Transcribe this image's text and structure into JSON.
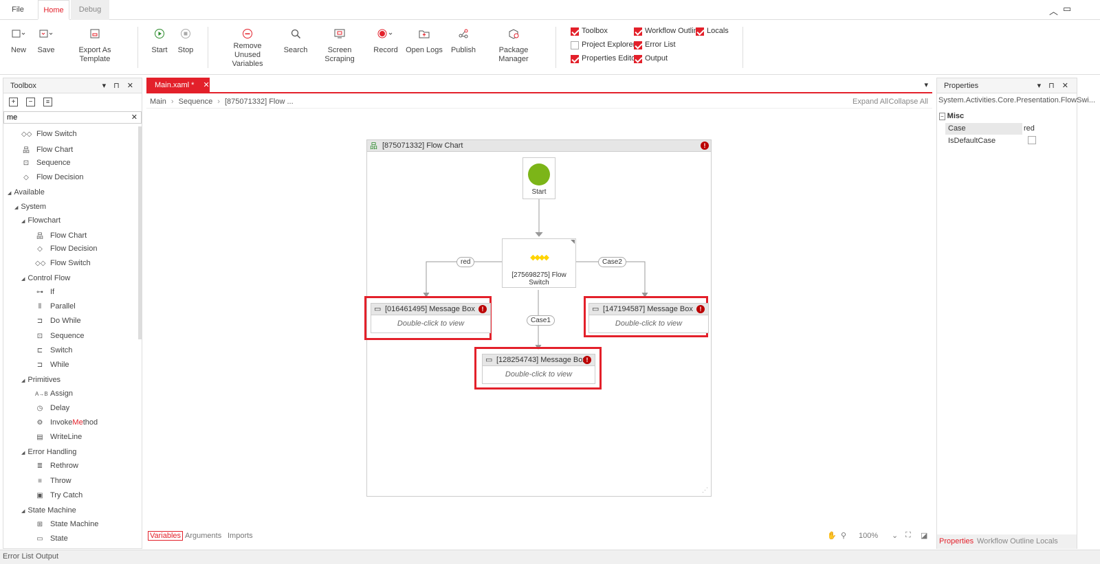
{
  "menubar": {
    "file": "File",
    "home": "Home",
    "debug": "Debug"
  },
  "ribbon": {
    "new": "New",
    "save": "Save",
    "export_template": "Export As Template",
    "start": "Start",
    "stop": "Stop",
    "remove_unused_1": "Remove Unused",
    "remove_unused_2": "Variables",
    "search": "Search",
    "screen_scraping": "Screen Scraping",
    "record": "Record",
    "open_logs": "Open Logs",
    "publish": "Publish",
    "package_manager": "Package Manager",
    "panels": [
      {
        "label": "Toolbox",
        "checked": true
      },
      {
        "label": "Project Explorer",
        "checked": false
      },
      {
        "label": "Properties Editor",
        "checked": true
      },
      {
        "label": "Workflow Outline",
        "checked": true
      },
      {
        "label": "Error List",
        "checked": true
      },
      {
        "label": "Output",
        "checked": true
      },
      {
        "label": "Locals",
        "checked": true
      }
    ]
  },
  "toolbox": {
    "title": "Toolbox",
    "search_value": "me",
    "recent": [
      "Flow Switch",
      "Flow Chart",
      "Sequence",
      "Flow Decision"
    ],
    "available": "Available",
    "system": "System",
    "flowchart": "Flowchart",
    "flowchart_items": [
      "Flow Chart",
      "Flow Decision",
      "Flow Switch"
    ],
    "control_flow": "Control Flow",
    "control_items": [
      "If",
      "Parallel",
      "Do While",
      "Sequence",
      "Switch",
      "While"
    ],
    "primitives": "Primitives",
    "primitive_items": [
      "Assign",
      "Delay",
      "InvokeMethod",
      "WriteLine"
    ],
    "invoke_pre": "Invoke",
    "invoke_hl": "Me",
    "invoke_post": "thod",
    "error_handling": "Error Handling",
    "error_items": [
      "Rethrow",
      "Throw",
      "Try Catch"
    ],
    "state_machine": "State Machine",
    "state_items": [
      "State Machine",
      "State"
    ]
  },
  "doc": {
    "tab": "Main.xaml *",
    "breadcrumb": [
      "Main",
      "Sequence",
      "[875071332] Flow ..."
    ],
    "expand_all": "Expand All",
    "collapse_all": "Collapse All"
  },
  "flowchart": {
    "title": "[875071332] Flow Chart",
    "start": "Start",
    "switch": "[275698275] Flow Switch",
    "edge_red": "red",
    "edge_case1": "Case1",
    "edge_case2": "Case2",
    "mb1": "[016461495] Message Box",
    "mb2": "[147194587] Message Box",
    "mb3": "[128254743] Message Box",
    "view": "Double-click to view"
  },
  "canvas_footer": {
    "variables": "Variables",
    "arguments": "Arguments",
    "imports": "Imports",
    "zoom": "100%"
  },
  "properties": {
    "title": "Properties",
    "type": "System.Activities.Core.Presentation.FlowSwi...",
    "misc": "Misc",
    "case_label": "Case",
    "case_value": "red",
    "default_label": "IsDefaultCase",
    "tabs": [
      "Properties",
      "Workflow Outline",
      "Locals"
    ]
  },
  "bottom": {
    "error_list": "Error List",
    "output": "Output"
  },
  "colors": {
    "accent": "#e3202a",
    "start_node": "#7cb518",
    "switch_diamond": "#ffd400"
  }
}
